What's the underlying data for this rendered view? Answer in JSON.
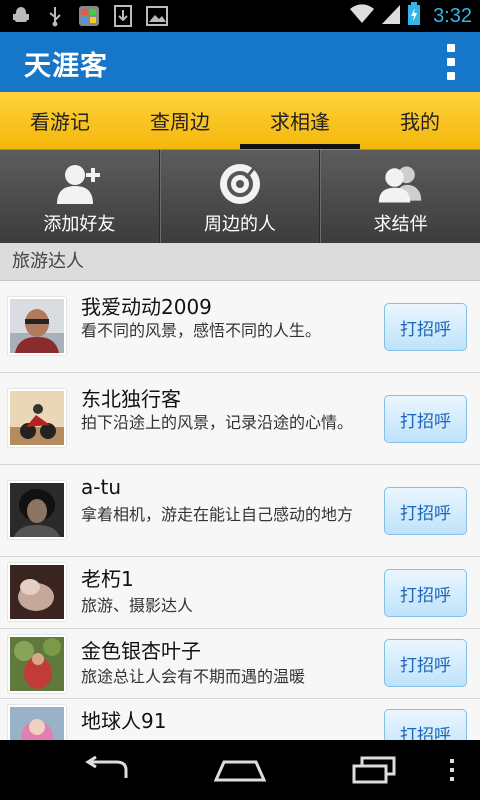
{
  "status_bar": {
    "time": "3:32",
    "icons": [
      "android-debug-icon",
      "usb-icon",
      "app-store-icon",
      "download-icon",
      "image-icon",
      "wifi-icon",
      "signal-icon",
      "battery-charging-icon"
    ]
  },
  "app_bar": {
    "title": "天涯客",
    "menu_icon": "overflow-menu-icon"
  },
  "tabs": [
    {
      "label": "看游记",
      "active": false
    },
    {
      "label": "查周边",
      "active": false
    },
    {
      "label": "求相逢",
      "active": true
    },
    {
      "label": "我的",
      "active": false
    }
  ],
  "actions": [
    {
      "label": "添加好友",
      "icon": "add-friend-icon"
    },
    {
      "label": "周边的人",
      "icon": "nearby-people-icon"
    },
    {
      "label": "求结伴",
      "icon": "find-companion-icon"
    }
  ],
  "section": {
    "title": "旅游达人"
  },
  "users": [
    {
      "name": "我爱动动2009",
      "desc": "看不同的风景，感悟不同的人生。",
      "button": "打招呼"
    },
    {
      "name": "东北独行客",
      "desc": "拍下沿途上的风景，记录沿途的心情。",
      "button": "打招呼"
    },
    {
      "name": "a-tu",
      "desc": "拿着相机，游走在能让自己感动的地方",
      "button": "打招呼"
    },
    {
      "name": "老朽1",
      "desc": "旅游、摄影达人",
      "button": "打招呼"
    },
    {
      "name": "金色银杏叶子",
      "desc": "旅途总让人会有不期而遇的温暖",
      "button": "打招呼"
    },
    {
      "name": "地球人91",
      "desc": "",
      "button": "打招呼"
    }
  ],
  "nav_bar": {
    "icons": [
      "back-icon",
      "home-icon",
      "recent-apps-icon",
      "menu-icon"
    ]
  },
  "colors": {
    "app_bar": "#1676c8",
    "tab_bar": "#f4b70b",
    "time": "#33b5e5",
    "button_text": "#1c64b7"
  }
}
